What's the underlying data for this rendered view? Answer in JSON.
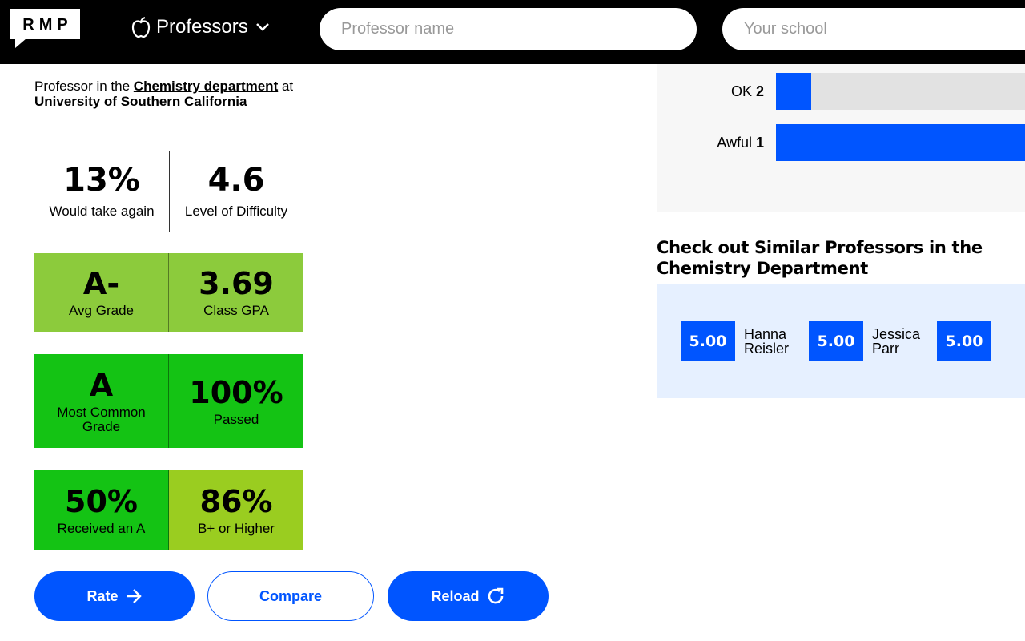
{
  "header": {
    "logo": "RMP",
    "menu_label": "Professors",
    "professor_placeholder": "Professor name",
    "school_placeholder": "Your school"
  },
  "subtitle": {
    "prefix": "Professor in the",
    "department": "Chemistry department",
    "at": "at",
    "school": "University of Southern California"
  },
  "stats": [
    {
      "value": "13%",
      "label": "Would take again"
    },
    {
      "value": "4.6",
      "label": "Level of Difficulty"
    }
  ],
  "grade_boxes": [
    {
      "value": "A-",
      "label": "Avg Grade",
      "color": "#8ccb3c"
    },
    {
      "value": "3.69",
      "label": "Class GPA",
      "color": "#8ccb3c"
    },
    {
      "value": "A",
      "label": "Most Common Grade",
      "color": "#14c314"
    },
    {
      "value": "100%",
      "label": "Passed",
      "color": "#14c314"
    },
    {
      "value": "50%",
      "label": "Received an A",
      "color": "#14c314"
    },
    {
      "value": "86%",
      "label": "B+ or Higher",
      "color": "#9acd20"
    }
  ],
  "buttons": {
    "rate": "Rate",
    "compare": "Compare",
    "reload": "Reload"
  },
  "distribution": [
    {
      "label": "OK",
      "count": "2",
      "fill_pct": 14
    },
    {
      "label": "Awful",
      "count": "1",
      "fill_pct": 100
    }
  ],
  "similar": {
    "title": "Check out Similar Professors in the Chemistry Department",
    "professors": [
      {
        "rating": "5.00",
        "name": "Hanna Reisler"
      },
      {
        "rating": "5.00",
        "name": "Jessica Parr"
      },
      {
        "rating": "5.00",
        "name": ""
      }
    ]
  }
}
